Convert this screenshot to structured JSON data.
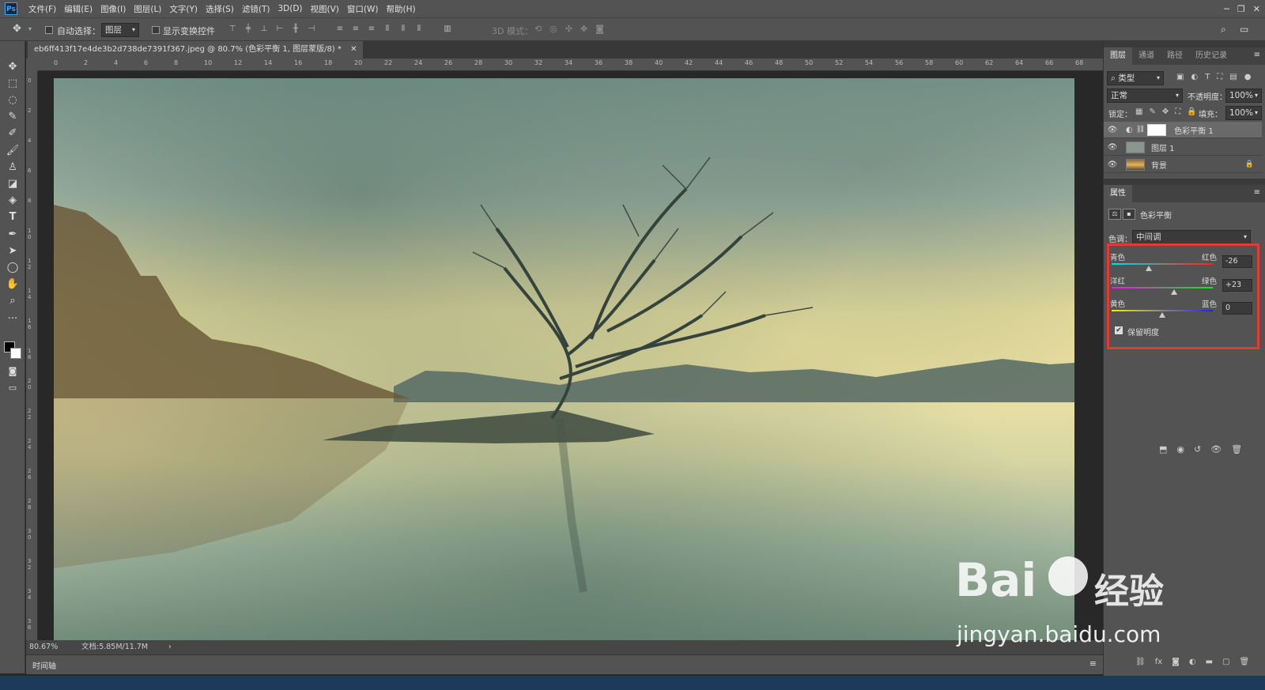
{
  "app": {
    "logo": "Ps"
  },
  "menu": [
    "文件(F)",
    "编辑(E)",
    "图像(I)",
    "图层(L)",
    "文字(Y)",
    "选择(S)",
    "滤镜(T)",
    "3D(D)",
    "视图(V)",
    "窗口(W)",
    "帮助(H)"
  ],
  "options": {
    "auto_select_label": "自动选择：",
    "auto_select_value": "图层",
    "show_transform_label": "显示变换控件",
    "mode3d_label": "3D 模式："
  },
  "document": {
    "tab_title": "eb6ff413f17e4de3b2d738de7391f367.jpeg @ 80.7% (色彩平衡 1, 图层蒙版/8) *"
  },
  "ruler": {
    "top": [
      "0",
      "2",
      "4",
      "6",
      "8",
      "10",
      "12",
      "14",
      "16",
      "18",
      "20",
      "22",
      "24",
      "26",
      "28",
      "30",
      "32",
      "34",
      "36",
      "38",
      "40",
      "42",
      "44",
      "46",
      "48",
      "50",
      "52",
      "54",
      "56",
      "58",
      "60",
      "62",
      "64",
      "66",
      "68"
    ],
    "left": [
      "0",
      "2",
      "4",
      "6",
      "8",
      "1 0",
      "1 2",
      "1 4",
      "1 6",
      "1 8",
      "2 0",
      "2 2",
      "2 4",
      "2 6",
      "2 8",
      "3 0",
      "3 2",
      "3 4",
      "3 6"
    ]
  },
  "status": {
    "zoom": "80.67%",
    "doc": "文档:5.85M/11.7M"
  },
  "timeline": {
    "label": "时间轴"
  },
  "layers_panel": {
    "tabs": [
      "图层",
      "通道",
      "路径",
      "历史记录"
    ],
    "filter": "类型",
    "blend_mode": "正常",
    "opacity_label": "不透明度：",
    "opacity": "100%",
    "lock_label": "锁定：",
    "fill_label": "填充：",
    "fill": "100%",
    "layers": [
      {
        "name": "色彩平衡 1"
      },
      {
        "name": "图层 1"
      },
      {
        "name": "背景"
      }
    ]
  },
  "properties": {
    "tab": "属性",
    "title": "色彩平衡",
    "tone_label": "色调：",
    "tone_value": "中间调",
    "sliders": [
      {
        "left": "青色",
        "right": "红色",
        "value": "-26",
        "amount": -26
      },
      {
        "left": "洋红",
        "right": "绿色",
        "value": "+23",
        "amount": 23
      },
      {
        "left": "黄色",
        "right": "蓝色",
        "value": "0",
        "amount": 0
      }
    ],
    "preserve_luminosity": "保留明度"
  },
  "watermark": {
    "brand": "Bai",
    "brand2": "经验",
    "url": "jingyan.baidu.com"
  },
  "colors": {
    "accent": "#31a8ff",
    "highlight_box": "#e53935"
  }
}
